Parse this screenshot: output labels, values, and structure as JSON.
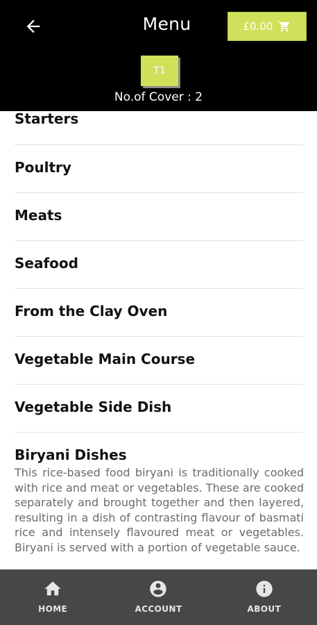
{
  "colors": {
    "header_bg": "#000000",
    "accent": "#cfe05a",
    "nav_bg": "#474747",
    "text": "#111111",
    "muted": "#6b6b6b"
  },
  "header": {
    "title": "Menu",
    "back_icon": "arrow-left-icon",
    "cart": {
      "amount": "£0.00",
      "icon": "shopping-cart-icon"
    },
    "table": {
      "label": "T1"
    },
    "covers": "No.of Cover : 2"
  },
  "categories": [
    {
      "label": "Starters"
    },
    {
      "label": "Poultry"
    },
    {
      "label": "Meats"
    },
    {
      "label": "Seafood"
    },
    {
      "label": "From the Clay Oven"
    },
    {
      "label": "Vegetable Main Course"
    },
    {
      "label": "Vegetable Side Dish"
    },
    {
      "label": "Biryani Dishes",
      "description": "This rice-based food biryani is traditionally cooked with rice and meat or vegetables. These are cooked separately and brought together and then layered, resulting in a dish of contrasting flavour of basmati rice and intensely flavoured meat or vegetables. Biryani is served with a portion of vegetable sauce."
    }
  ],
  "bottom_nav": [
    {
      "label": "HOME",
      "icon": "home-icon"
    },
    {
      "label": "ACCOUNT",
      "icon": "account-circle-icon"
    },
    {
      "label": "ABOUT",
      "icon": "info-icon"
    }
  ]
}
